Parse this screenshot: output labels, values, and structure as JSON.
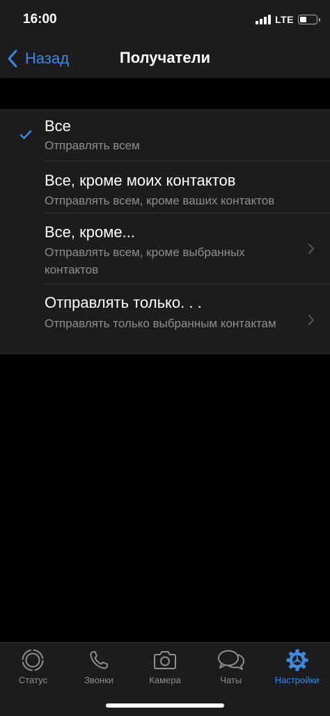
{
  "status_bar": {
    "time": "16:00",
    "network": "LTE"
  },
  "nav": {
    "back_label": "Назад",
    "title": "Получатели"
  },
  "options": [
    {
      "title": "Все",
      "subtitle": "Отправлять всем",
      "selected": true
    },
    {
      "title": "Все, кроме моих контактов",
      "subtitle": "Отправлять всем, кроме ваших контактов",
      "selected": false
    },
    {
      "title": "Все, кроме...",
      "subtitle": "Отправлять всем, кроме выбранных контактов",
      "selected": false
    },
    {
      "title": "Отправлять только. . .",
      "subtitle": "Отправлять только выбранным контактам",
      "selected": false
    }
  ],
  "tabs": [
    {
      "label": "Статус",
      "icon": "status-icon",
      "active": false
    },
    {
      "label": "Звонки",
      "icon": "phone-icon",
      "active": false
    },
    {
      "label": "Камера",
      "icon": "camera-icon",
      "active": false
    },
    {
      "label": "Чаты",
      "icon": "chats-icon",
      "active": false
    },
    {
      "label": "Настройки",
      "icon": "settings-gear-icon",
      "active": true
    }
  ],
  "colors": {
    "accent": "#3d8ae0",
    "background": "#000000",
    "surface": "#1c1c1e",
    "secondary_text": "#8e8e93"
  }
}
